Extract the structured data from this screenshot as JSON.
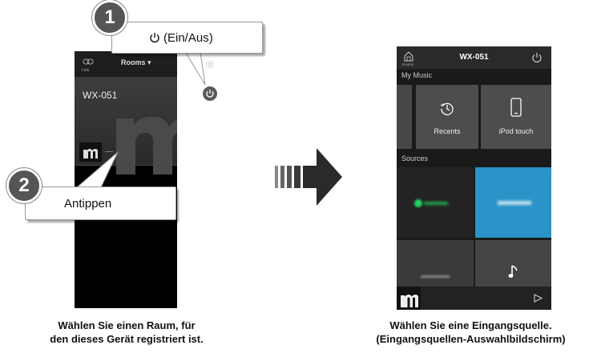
{
  "step1": {
    "number": "1",
    "label": "(Ein/Aus)"
  },
  "step2": {
    "number": "2",
    "label": "Antippen"
  },
  "left_phone": {
    "link_label": "Link",
    "rooms_label": "Rooms",
    "room_name": "WX-051"
  },
  "right_phone": {
    "home_label": "Rooms",
    "title": "WX-051",
    "my_music_label": "My Music",
    "tiles": {
      "recents": "Recents",
      "ipod": "iPod touch"
    },
    "sources_label": "Sources"
  },
  "captions": {
    "left_line1": "Wählen Sie einen Raum, für",
    "left_line2": "den dieses Gerät registriert ist.",
    "right_line1": "Wählen Sie eine Eingangsquelle.",
    "right_line2": "(Eingangsquellen-Auswahlbildschirm)"
  },
  "colors": {
    "accent_blue": "#2a93c8",
    "spotify_green": "#1ed760",
    "badge_gray": "#555555"
  }
}
